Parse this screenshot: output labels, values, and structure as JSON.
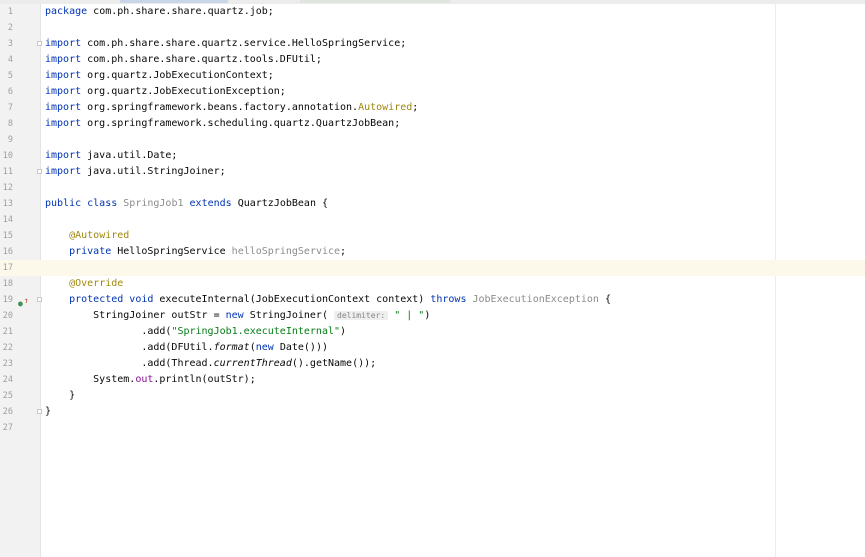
{
  "editor": {
    "lines": [
      {
        "n": "1",
        "tokens": [
          {
            "t": "package",
            "k": "kw"
          },
          {
            "t": " com.ph.share.share.quartz.job;"
          }
        ]
      },
      {
        "n": "2",
        "tokens": []
      },
      {
        "n": "3",
        "fold": true,
        "tokens": [
          {
            "t": "import",
            "k": "kw"
          },
          {
            "t": " com.ph.share.share.quartz.service.HelloSpringService;"
          }
        ]
      },
      {
        "n": "4",
        "tokens": [
          {
            "t": "import",
            "k": "kw"
          },
          {
            "t": " com.ph.share.share.quartz.tools.DFUtil;"
          }
        ]
      },
      {
        "n": "5",
        "tokens": [
          {
            "t": "import",
            "k": "kw"
          },
          {
            "t": " org.quartz.JobExecutionContext;"
          }
        ]
      },
      {
        "n": "6",
        "tokens": [
          {
            "t": "import",
            "k": "kw"
          },
          {
            "t": " org.quartz.JobExecutionException;"
          }
        ]
      },
      {
        "n": "7",
        "tokens": [
          {
            "t": "import",
            "k": "kw"
          },
          {
            "t": " org.springframework.beans.factory.annotation."
          },
          {
            "t": "Autowired",
            "k": "ann"
          },
          {
            "t": ";"
          }
        ]
      },
      {
        "n": "8",
        "tokens": [
          {
            "t": "import",
            "k": "kw"
          },
          {
            "t": " org.springframework.scheduling.quartz.QuartzJobBean;"
          }
        ]
      },
      {
        "n": "9",
        "tokens": []
      },
      {
        "n": "10",
        "tokens": [
          {
            "t": "import",
            "k": "kw"
          },
          {
            "t": " java.util.Date;"
          }
        ]
      },
      {
        "n": "11",
        "fold": true,
        "tokens": [
          {
            "t": "import",
            "k": "kw"
          },
          {
            "t": " java.util.StringJoiner;"
          }
        ]
      },
      {
        "n": "12",
        "tokens": []
      },
      {
        "n": "13",
        "tokens": [
          {
            "t": "public class",
            "k": "kw"
          },
          {
            "t": " "
          },
          {
            "t": "SpringJob1",
            "k": "gray"
          },
          {
            "t": " "
          },
          {
            "t": "extends",
            "k": "kw"
          },
          {
            "t": " QuartzJobBean {"
          }
        ]
      },
      {
        "n": "14",
        "tokens": []
      },
      {
        "n": "15",
        "tokens": [
          {
            "t": "    "
          },
          {
            "t": "@Autowired",
            "k": "ann"
          }
        ]
      },
      {
        "n": "16",
        "tokens": [
          {
            "t": "    "
          },
          {
            "t": "private",
            "k": "kw"
          },
          {
            "t": " HelloSpringService "
          },
          {
            "t": "helloSpringService",
            "k": "gray"
          },
          {
            "t": ";"
          }
        ]
      },
      {
        "n": "17",
        "current": true,
        "tokens": []
      },
      {
        "n": "18",
        "tokens": [
          {
            "t": "    "
          },
          {
            "t": "@Override",
            "k": "ann"
          }
        ]
      },
      {
        "n": "19",
        "fold": true,
        "marker": true,
        "tokens": [
          {
            "t": "    "
          },
          {
            "t": "protected void",
            "k": "kw"
          },
          {
            "t": " executeInternal(JobExecutionContext context) "
          },
          {
            "t": "throws",
            "k": "kw"
          },
          {
            "t": " "
          },
          {
            "t": "JobExecutionException",
            "k": "gray"
          },
          {
            "t": " {"
          }
        ]
      },
      {
        "n": "20",
        "tokens": [
          {
            "t": "        StringJoiner outStr = "
          },
          {
            "t": "new",
            "k": "kw"
          },
          {
            "t": " StringJoiner( "
          },
          {
            "t": "delimiter:",
            "k": "hint"
          },
          {
            "t": " "
          },
          {
            "t": "\" | \"",
            "k": "str"
          },
          {
            "t": ")"
          }
        ]
      },
      {
        "n": "21",
        "tokens": [
          {
            "t": "                .add("
          },
          {
            "t": "\"SpringJob1.executeInternal\"",
            "k": "str"
          },
          {
            "t": ")"
          }
        ]
      },
      {
        "n": "22",
        "tokens": [
          {
            "t": "                .add(DFUtil."
          },
          {
            "t": "format",
            "k": "it"
          },
          {
            "t": "("
          },
          {
            "t": "new",
            "k": "kw"
          },
          {
            "t": " Date()))"
          }
        ]
      },
      {
        "n": "23",
        "tokens": [
          {
            "t": "                .add(Thread."
          },
          {
            "t": "currentThread",
            "k": "it"
          },
          {
            "t": "().getName());"
          }
        ]
      },
      {
        "n": "24",
        "tokens": [
          {
            "t": "        System."
          },
          {
            "t": "out",
            "k": "fld"
          },
          {
            "t": ".println(outStr);"
          }
        ]
      },
      {
        "n": "25",
        "tokens": [
          {
            "t": "    }"
          }
        ]
      },
      {
        "n": "26",
        "fold": true,
        "tokens": [
          {
            "t": "}"
          }
        ]
      },
      {
        "n": "27",
        "tokens": []
      }
    ],
    "gutter_icons": {
      "override": "override-implements-icon",
      "fold": "fold-marker-icon"
    }
  },
  "colors": {
    "keyword": "#0033b3",
    "annotation": "#9e880d",
    "string": "#067d17",
    "field": "#871094",
    "unused": "#8c8c8c",
    "current_line": "#fdf9ea"
  }
}
